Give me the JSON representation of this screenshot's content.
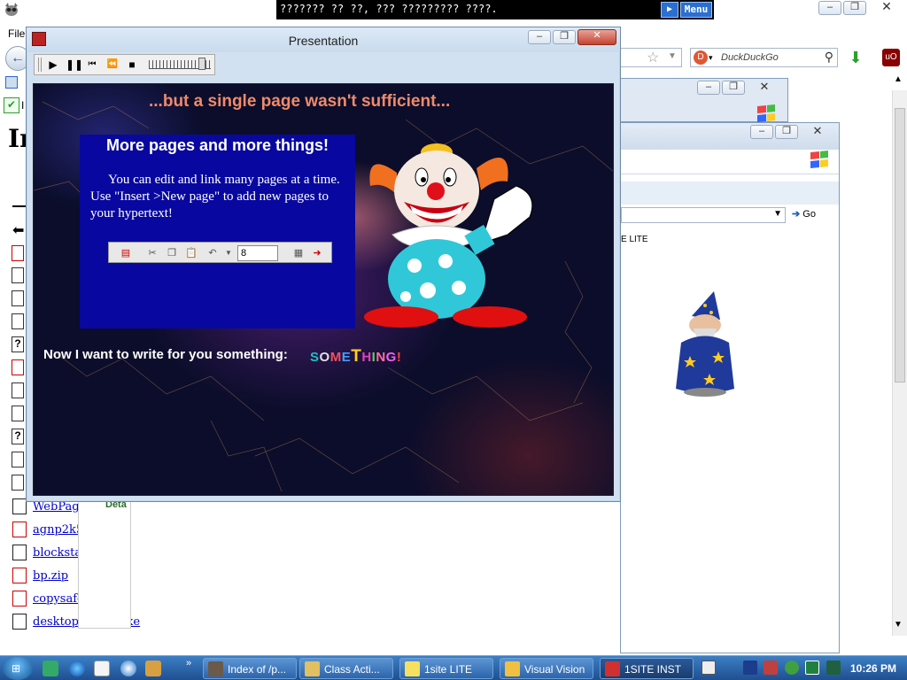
{
  "top_bar": {
    "title_text": "??????? ?? ??, ??? ????????? ????.",
    "menu_label": "Menu",
    "play_glyph": "▶"
  },
  "browser": {
    "menu_file": "File",
    "search_placeholder": "DuckDuckGo",
    "heading_initial": "In",
    "files": [
      {
        "name": "WebPag"
      },
      {
        "name": "agnp2k5"
      },
      {
        "name": "blocksta"
      },
      {
        "name": "bp.zip"
      },
      {
        "name": "copysafe"
      },
      {
        "name": "desktopauthor.exe"
      }
    ],
    "details_label": "Deta"
  },
  "win3": {
    "go_label": "Go",
    "lite_text": "E LITE"
  },
  "presentation": {
    "title": "Presentation",
    "heading": "...but a single page wasn't sufficient...",
    "panel_title": "More pages and more things!",
    "panel_text": "You can edit and link many pages at a time. Use \"Insert >New page\" to add new pages to your hypertext!",
    "spin_value": "8",
    "write_line": "Now I want to write for you something:",
    "something_letters": [
      {
        "ch": "S",
        "color": "#20c0c0"
      },
      {
        "ch": "O",
        "color": "#e0e0e0"
      },
      {
        "ch": "M",
        "color": "#f05060"
      },
      {
        "ch": "E",
        "color": "#40a0ff"
      },
      {
        "ch": "T",
        "color": "#ffd020"
      },
      {
        "ch": "H",
        "color": "#e040c0"
      },
      {
        "ch": "I",
        "color": "#60d060"
      },
      {
        "ch": "N",
        "color": "#ff70a0"
      },
      {
        "ch": "G",
        "color": "#f060f0"
      },
      {
        "ch": "!",
        "color": "#ff4040"
      }
    ]
  },
  "taskbar": {
    "tasks": [
      {
        "label": "Index of /p...",
        "icon": "raccoon-icon",
        "color": "#6b5a4a"
      },
      {
        "label": "Class Acti...",
        "icon": "app-icon",
        "color": "#e0c060"
      },
      {
        "label": "1site LITE",
        "icon": "1site-icon",
        "color": "#f5e060"
      },
      {
        "label": "Visual Vision",
        "icon": "folder-icon",
        "color": "#f0c040"
      },
      {
        "label": "1SITE INST",
        "icon": "installer-icon",
        "color": "#d03030"
      }
    ],
    "clock": "10:26 PM"
  }
}
